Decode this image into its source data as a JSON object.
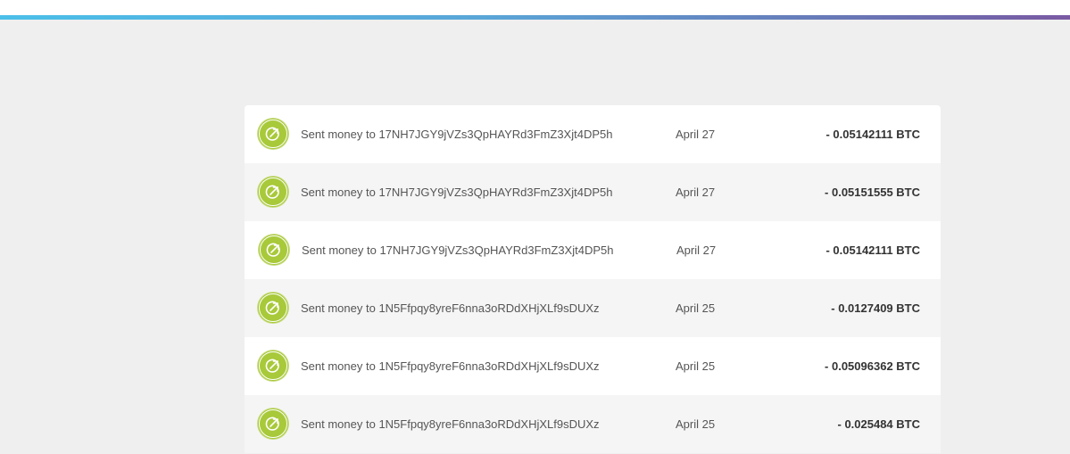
{
  "header": {
    "accent_gradient": [
      "#4bbfe8",
      "#7a5aa3"
    ]
  },
  "transactions": [
    {
      "icon": "sent-arrow-icon",
      "description": "Sent money to 17NH7JGY9jVZs3QpHAYRd3FmZ3Xjt4DP5h",
      "date": "April 27",
      "amount": "- 0.05142111 BTC"
    },
    {
      "icon": "sent-arrow-icon",
      "description": "Sent money to 17NH7JGY9jVZs3QpHAYRd3FmZ3Xjt4DP5h",
      "date": "April 27",
      "amount": "- 0.05151555 BTC"
    },
    {
      "icon": "sent-arrow-icon",
      "description": "Sent money to 17NH7JGY9jVZs3QpHAYRd3FmZ3Xjt4DP5h",
      "date": "April 27",
      "amount": "- 0.05142111 BTC"
    },
    {
      "icon": "sent-arrow-icon",
      "description": "Sent money to 1N5Ffpqy8yreF6nna3oRDdXHjXLf9sDUXz",
      "date": "April 25",
      "amount": "- 0.0127409 BTC"
    },
    {
      "icon": "sent-arrow-icon",
      "description": "Sent money to 1N5Ffpqy8yreF6nna3oRDdXHjXLf9sDUXz",
      "date": "April 25",
      "amount": "- 0.05096362 BTC"
    },
    {
      "icon": "sent-arrow-icon",
      "description": "Sent money to 1N5Ffpqy8yreF6nna3oRDdXHjXLf9sDUXz",
      "date": "April 25",
      "amount": "- 0.025484 BTC"
    }
  ],
  "colors": {
    "sent_icon": "#a8c93a",
    "row_white": "#ffffff",
    "row_gray": "#f5f5f5",
    "page_background": "#efefef",
    "amount_text": "#333333",
    "body_text": "#555555"
  }
}
